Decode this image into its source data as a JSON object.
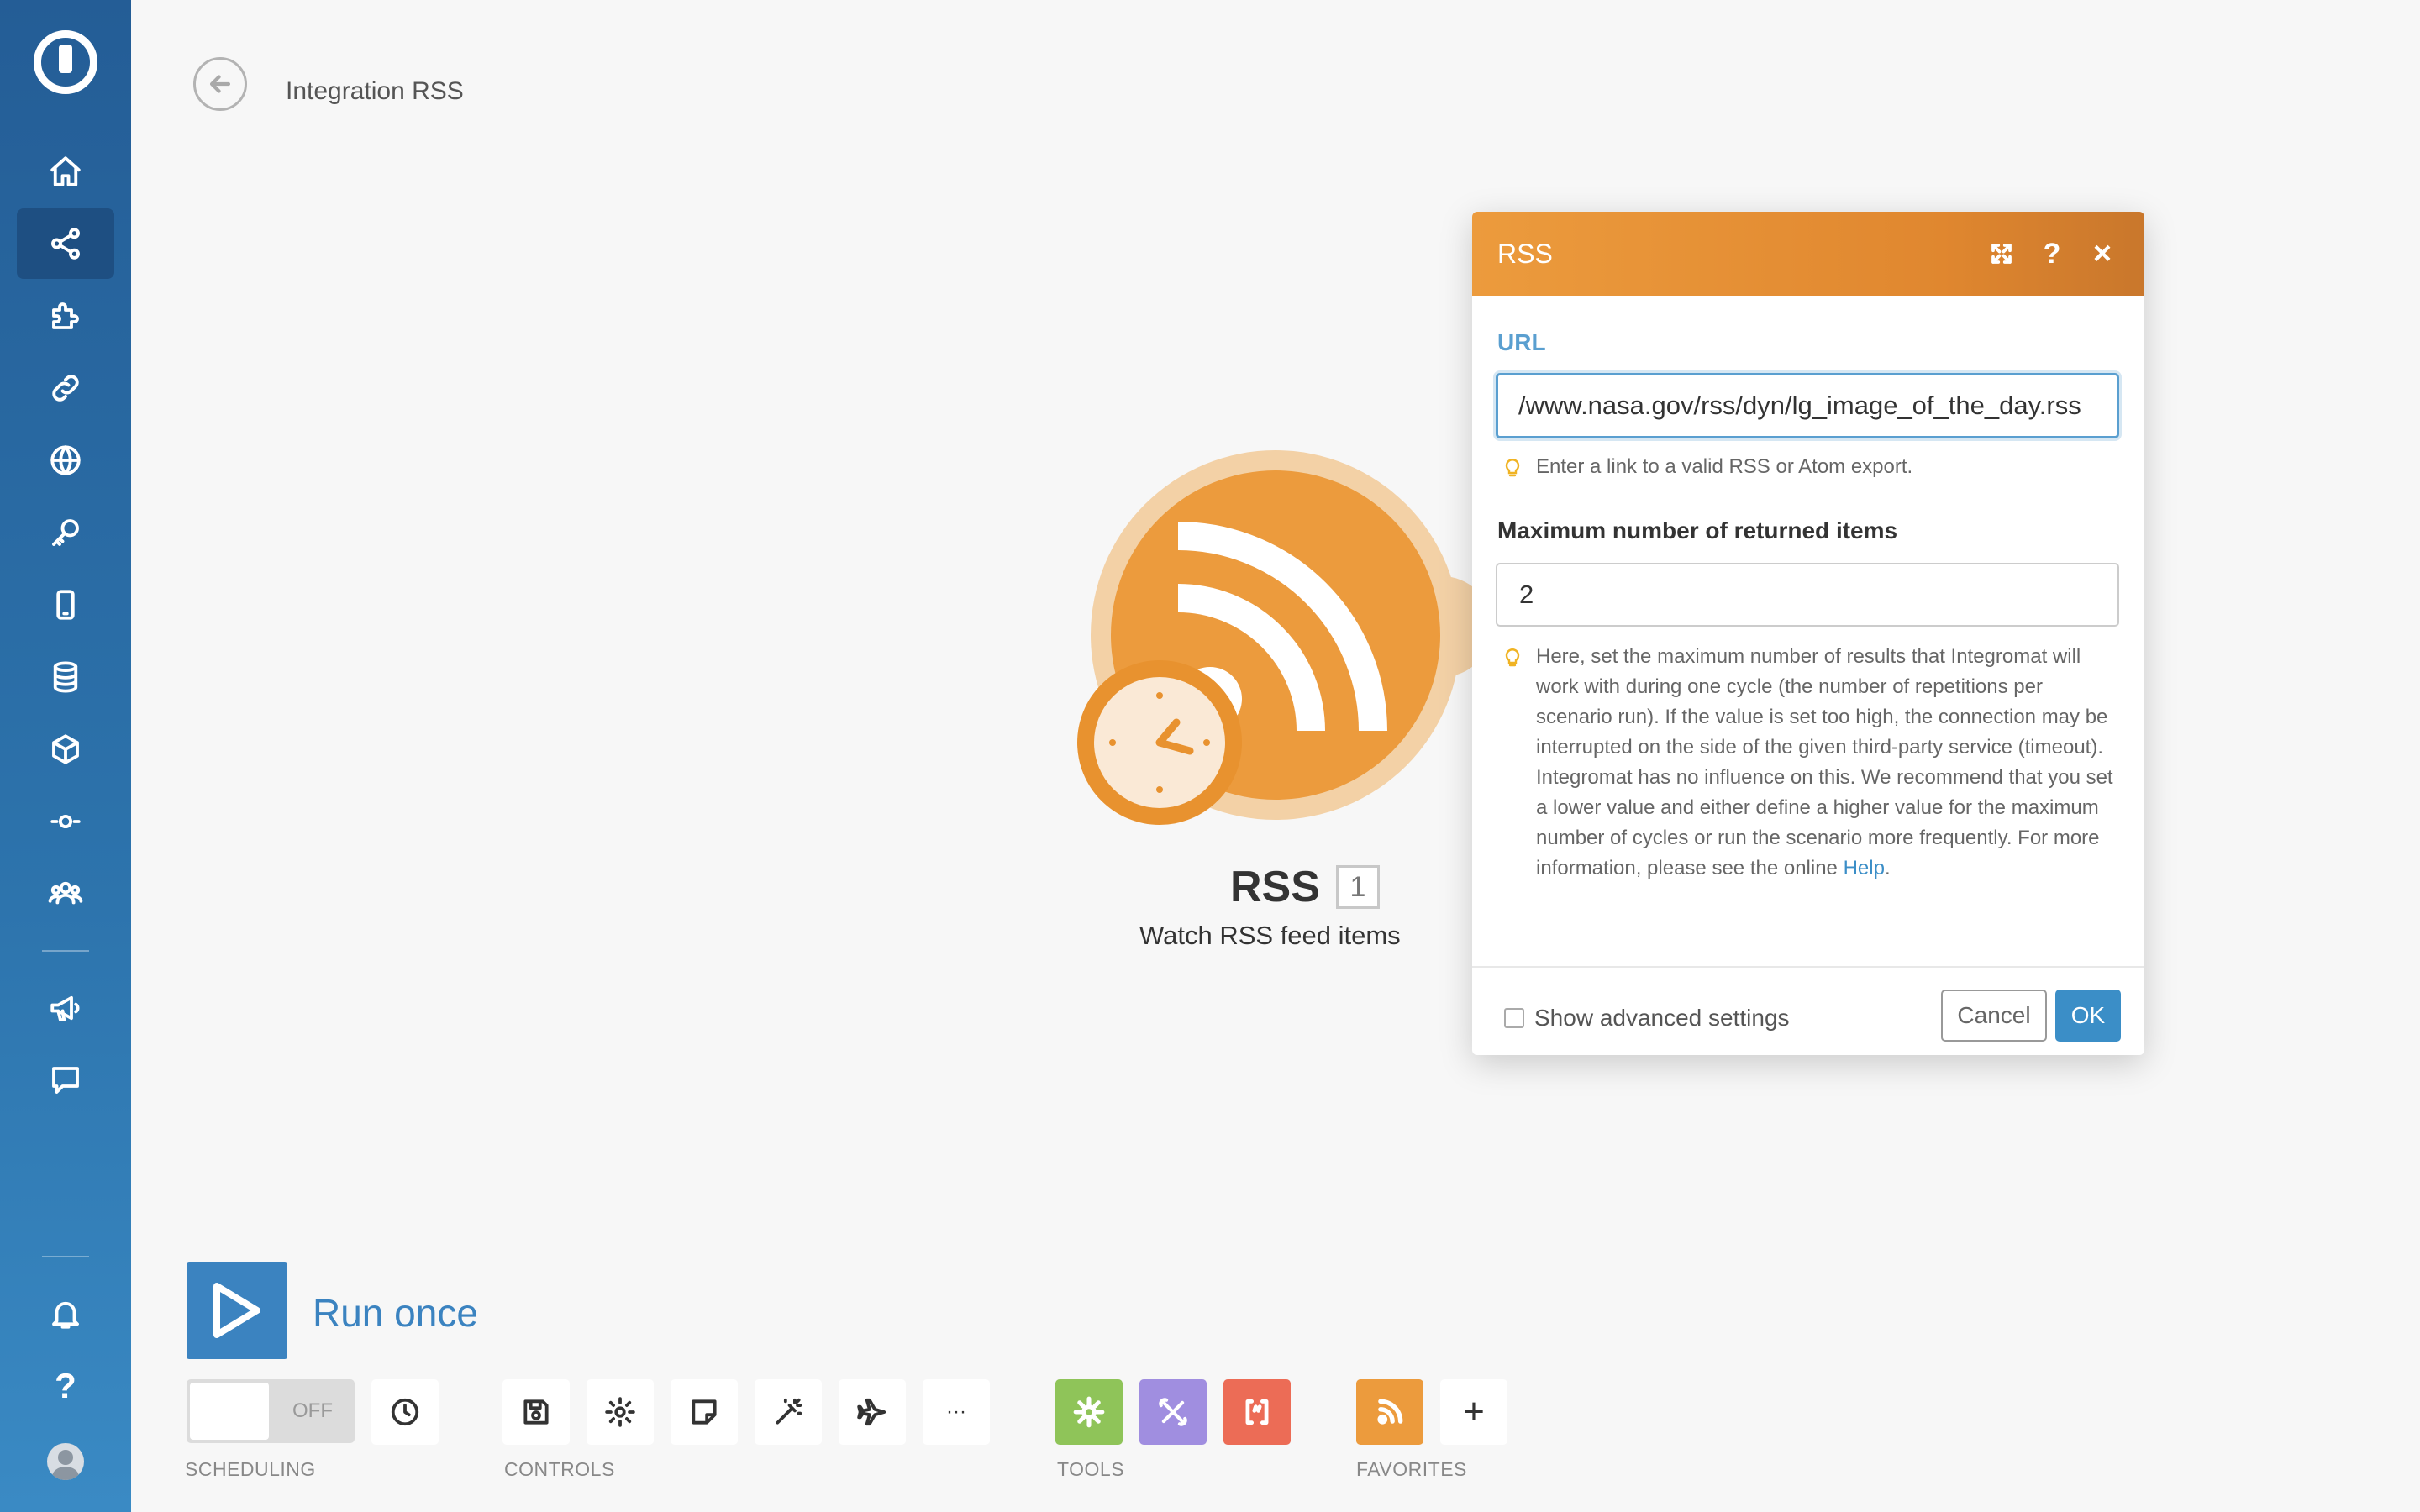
{
  "header": {
    "title": "Integration RSS"
  },
  "sidebar": {
    "items": [
      {
        "name": "home",
        "active": false
      },
      {
        "name": "scenarios",
        "active": true
      },
      {
        "name": "templates",
        "active": false
      },
      {
        "name": "connections",
        "active": false
      },
      {
        "name": "webhooks",
        "active": false
      },
      {
        "name": "keys",
        "active": false
      },
      {
        "name": "devices",
        "active": false
      },
      {
        "name": "data-stores",
        "active": false
      },
      {
        "name": "data-structures",
        "active": false
      },
      {
        "name": "custom-apps",
        "active": false
      },
      {
        "name": "team",
        "active": false
      },
      {
        "name": "announcements",
        "active": false
      },
      {
        "name": "support",
        "active": false
      },
      {
        "name": "notifications",
        "active": false
      },
      {
        "name": "help",
        "active": false
      }
    ],
    "help_glyph": "?"
  },
  "module": {
    "name": "RSS",
    "badge": "1",
    "description": "Watch RSS feed items",
    "color": "#ec9b3d"
  },
  "dialog": {
    "title": "RSS",
    "help_glyph": "?",
    "close_glyph": "×",
    "url_label": "URL",
    "url_value": "/www.nasa.gov/rss/dyn/lg_image_of_the_day.rss",
    "url_hint": "Enter a link to a valid RSS or Atom export.",
    "max_label": "Maximum number of returned items",
    "max_value": "2",
    "max_hint": "Here, set the maximum number of results that Integromat will work with during one cycle (the number of repetitions per scenario run). If the value is set too high, the connection may be interrupted on the side of the given third-party service (timeout). Integromat has no influence on this. We recommend that you set a lower value and either define a higher value for the maximum number of cycles or run the scenario more frequently. For more information, please see the online ",
    "max_hint_link": "Help",
    "max_hint_end": ".",
    "advanced_label": "Show advanced settings",
    "cancel_label": "Cancel",
    "ok_label": "OK"
  },
  "toolbar": {
    "run_label": "Run once",
    "toggle_state": "OFF",
    "more_glyph": "···",
    "plus_glyph": "+",
    "groups": {
      "scheduling": "SCHEDULING",
      "controls": "CONTROLS",
      "tools": "TOOLS",
      "favorites": "FAVORITES"
    },
    "tool_colors": {
      "flow": "#8fc459",
      "tools": "#a08ee0",
      "text": "#ec6c56",
      "rss": "#ec9b3d"
    }
  }
}
